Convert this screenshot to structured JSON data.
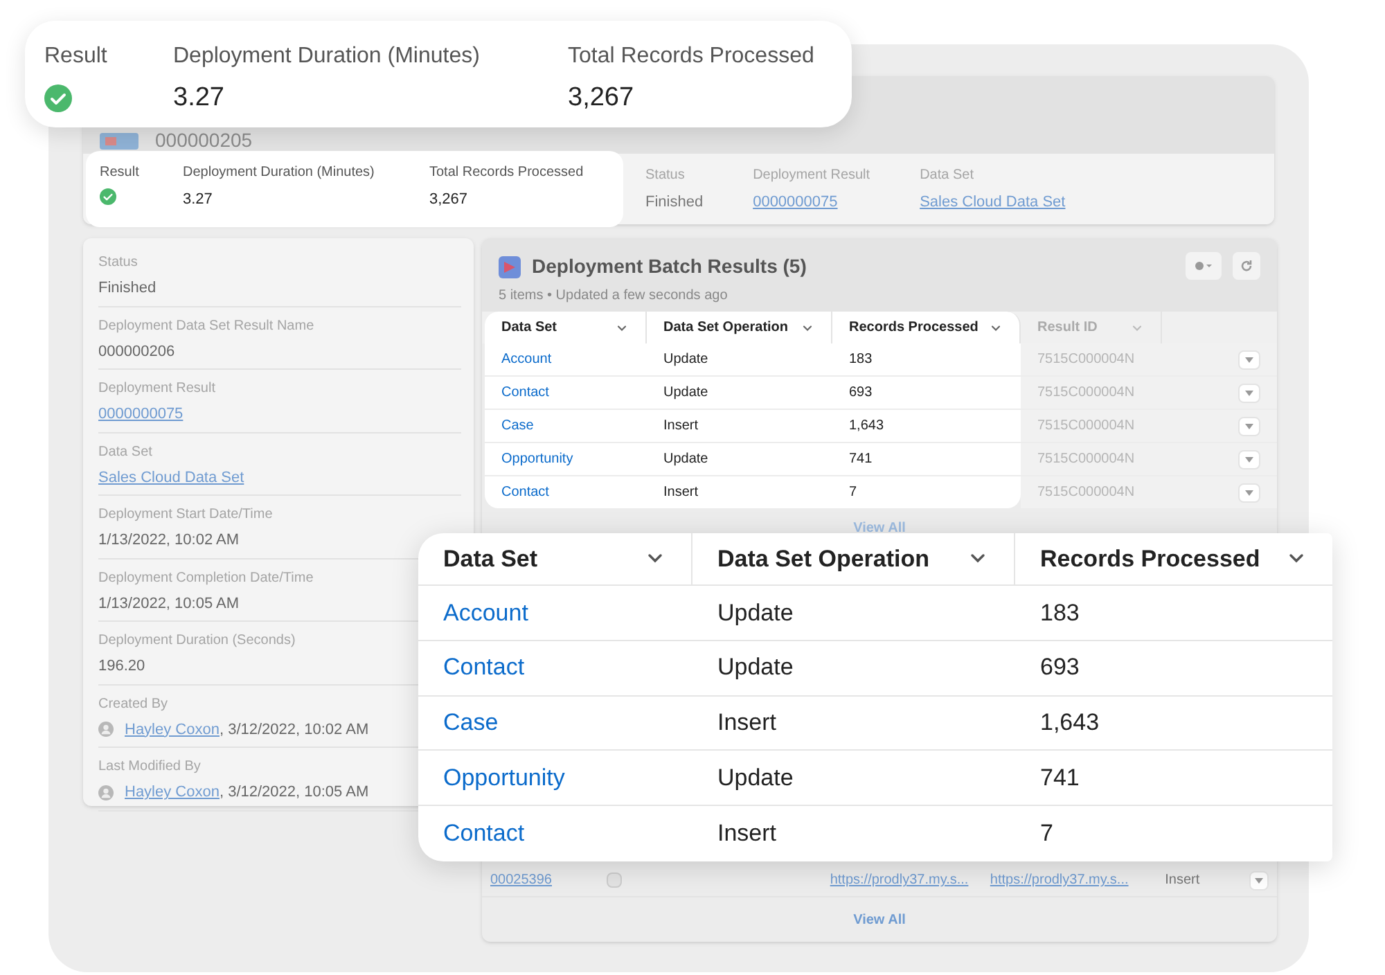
{
  "summary_callout": {
    "fields": [
      {
        "label": "Result",
        "kind": "status"
      },
      {
        "label": "Deployment Duration (Minutes)",
        "value": "3.27",
        "kind": "text"
      },
      {
        "label": "Total Records Processed",
        "value": "3,267",
        "kind": "text"
      }
    ]
  },
  "record": {
    "title": "000000205",
    "focused_fields": [
      {
        "label": "Result",
        "kind": "status"
      },
      {
        "label": "Deployment Duration (Minutes)",
        "value": "3.27",
        "kind": "text"
      },
      {
        "label": "Total Records Processed",
        "value": "3,267",
        "kind": "text"
      }
    ],
    "fields": [
      {
        "label": "Status",
        "value": "Finished",
        "kind": "text"
      },
      {
        "label": "Deployment Result",
        "value": "0000000075",
        "kind": "link"
      },
      {
        "label": "Data Set",
        "value": "Sales Cloud Data Set",
        "kind": "link"
      }
    ]
  },
  "details": [
    {
      "label": "Status",
      "value": "Finished",
      "kind": "text"
    },
    {
      "label": "Deployment Data Set Result Name",
      "value": "000000206",
      "kind": "text"
    },
    {
      "label": "Deployment Result",
      "value": "0000000075",
      "kind": "link"
    },
    {
      "label": "Data Set",
      "value": "Sales Cloud Data Set",
      "kind": "link"
    },
    {
      "label": "Deployment Start Date/Time",
      "value": "1/13/2022, 10:02 AM",
      "kind": "text"
    },
    {
      "label": "Deployment Completion Date/Time",
      "value": "1/13/2022, 10:05 AM",
      "kind": "text"
    },
    {
      "label": "Deployment Duration (Seconds)",
      "value": "196.20",
      "kind": "text"
    },
    {
      "label": "Created By",
      "value": "Hayley Coxon",
      "suffix": ", 3/12/2022, 10:02 AM",
      "kind": "user"
    },
    {
      "label": "Last Modified By",
      "value": "Hayley Coxon",
      "suffix": ", 3/12/2022, 10:05 AM",
      "kind": "user"
    }
  ],
  "batch_results": {
    "title": "Deployment Batch Results (5)",
    "subtitle": "5 items • Updated a few seconds ago",
    "columns": [
      "Data Set",
      "Data Set Operation",
      "Records Processed",
      "Result ID"
    ],
    "rows": [
      {
        "data_set": "Account",
        "operation": "Update",
        "records": "183",
        "result_id": "7515C000004N"
      },
      {
        "data_set": "Contact",
        "operation": "Update",
        "records": "693",
        "result_id": "7515C000004N"
      },
      {
        "data_set": "Case",
        "operation": "Insert",
        "records": "1,643",
        "result_id": "7515C000004N"
      },
      {
        "data_set": "Opportunity",
        "operation": "Update",
        "records": "741",
        "result_id": "7515C000004N"
      },
      {
        "data_set": "Contact",
        "operation": "Insert",
        "records": "7",
        "result_id": "7515C000004N"
      }
    ],
    "footer": "View All"
  },
  "second_list": {
    "row": {
      "name": "00025396",
      "checked": false,
      "source_url": "https://prodly37.my.s...",
      "target_url": "https://prodly37.my.s...",
      "operation": "Insert"
    },
    "footer": "View All"
  },
  "zoom_callout": {
    "columns": [
      "Data Set",
      "Data Set Operation",
      "Records Processed"
    ],
    "rows": [
      {
        "data_set": "Account",
        "operation": "Update",
        "records": "183"
      },
      {
        "data_set": "Contact",
        "operation": "Update",
        "records": "693"
      },
      {
        "data_set": "Case",
        "operation": "Insert",
        "records": "1,643"
      },
      {
        "data_set": "Opportunity",
        "operation": "Update",
        "records": "741"
      },
      {
        "data_set": "Contact",
        "operation": "Insert",
        "records": "7"
      }
    ]
  }
}
